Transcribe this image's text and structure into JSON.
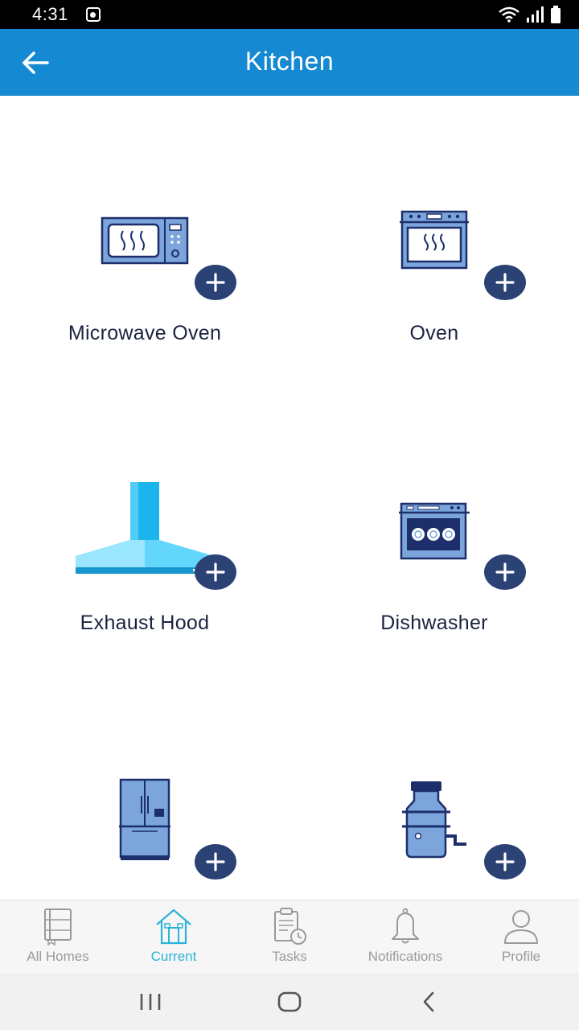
{
  "status_bar": {
    "time": "4:31",
    "icons": [
      "app-notification-icon",
      "wifi-icon",
      "signal-icon",
      "battery-icon"
    ]
  },
  "header": {
    "title": "Kitchen",
    "back_icon": "arrow-left-icon"
  },
  "appliances": [
    {
      "label": "Microwave Oven",
      "icon": "microwave-icon"
    },
    {
      "label": "Oven",
      "icon": "oven-icon"
    },
    {
      "label": "Exhaust Hood",
      "icon": "exhaust-hood-icon"
    },
    {
      "label": "Dishwasher",
      "icon": "dishwasher-icon"
    },
    {
      "label": "",
      "icon": "refrigerator-icon"
    },
    {
      "label": "",
      "icon": "garbage-disposal-icon"
    }
  ],
  "bottom_nav": {
    "items": [
      {
        "label": "All Homes",
        "icon": "book-icon",
        "active": false
      },
      {
        "label": "Current",
        "icon": "house-icon",
        "active": true
      },
      {
        "label": "Tasks",
        "icon": "clipboard-clock-icon",
        "active": false
      },
      {
        "label": "Notifications",
        "icon": "bell-icon",
        "active": false
      },
      {
        "label": "Profile",
        "icon": "user-icon",
        "active": false
      }
    ]
  },
  "colors": {
    "app_bar": "#1589d2",
    "add_button": "#2b4275",
    "active_nav": "#2cb3d9",
    "appliance_fill": "#7ba5db",
    "appliance_stroke": "#1d2f6b"
  }
}
